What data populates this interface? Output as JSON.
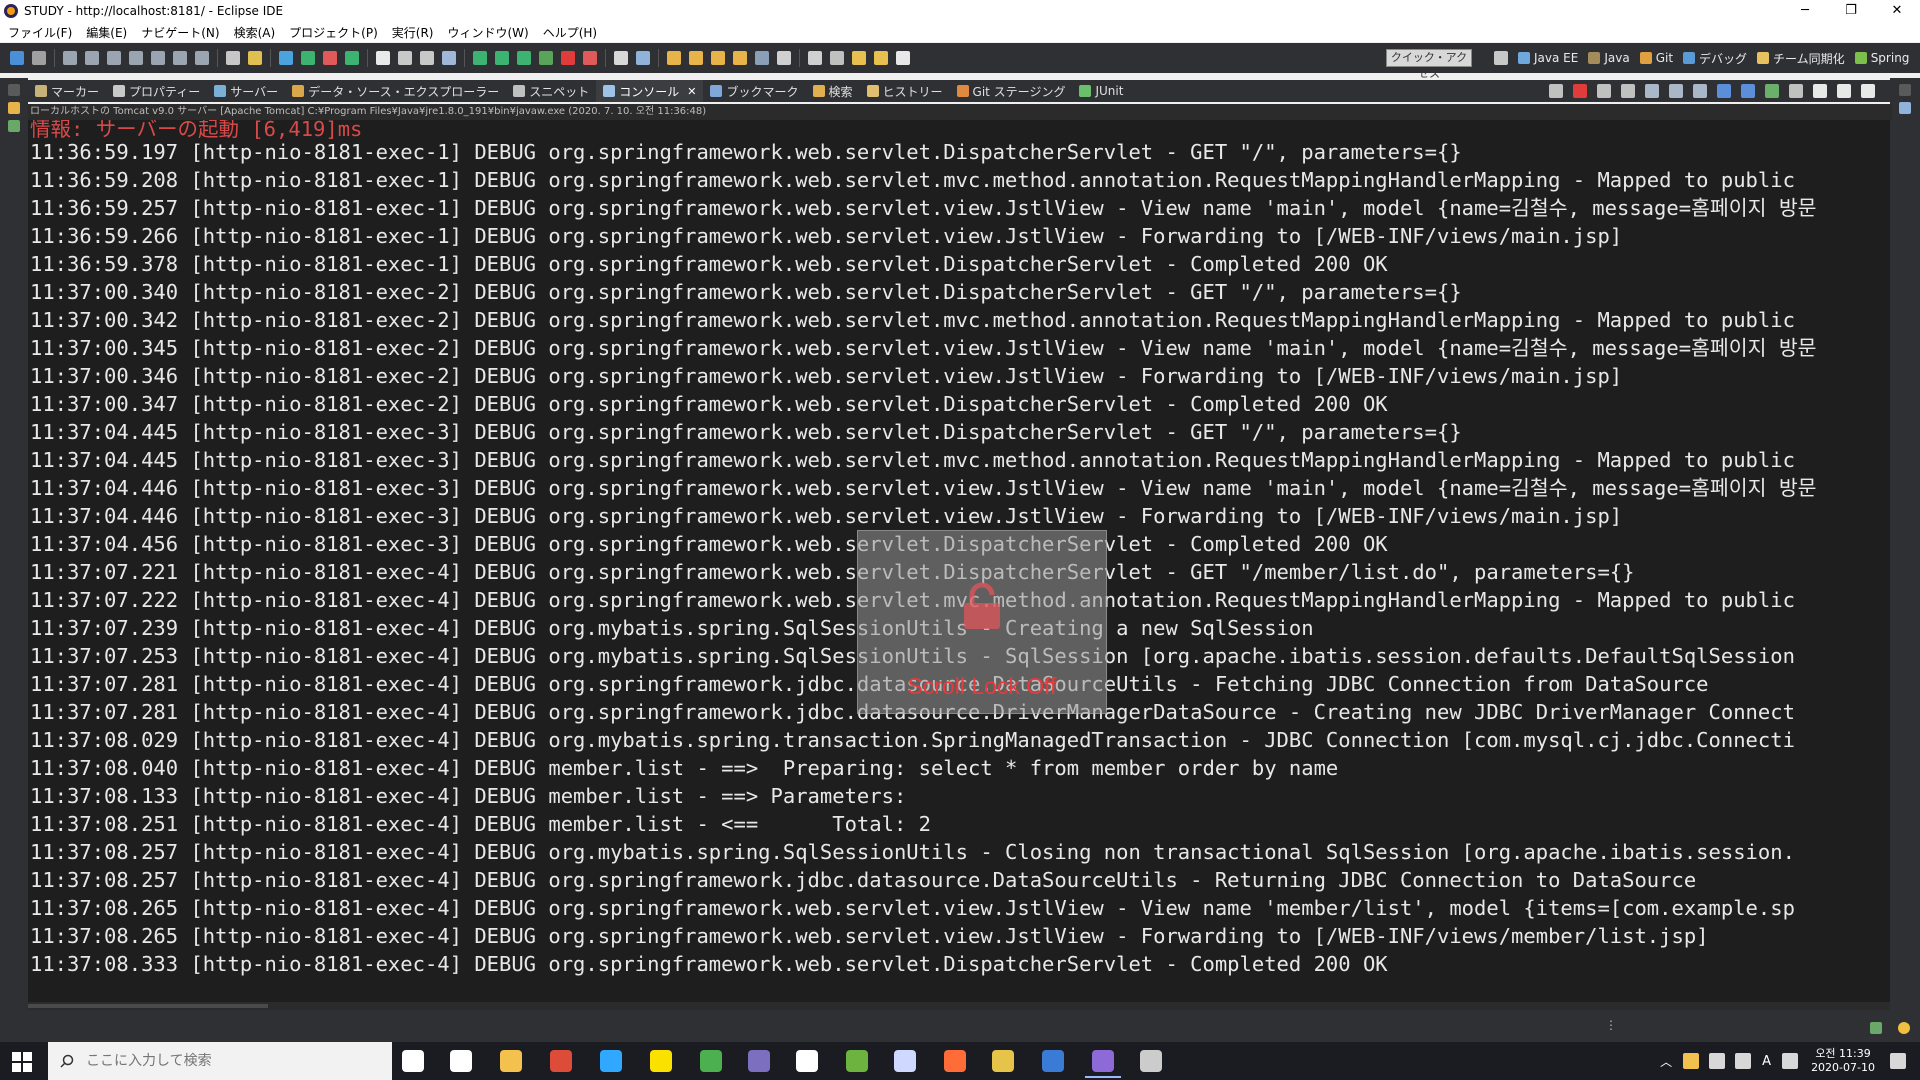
{
  "window": {
    "title": "STUDY - http://localhost:8181/ - Eclipse IDE",
    "controls": {
      "minimize": "─",
      "maximize": "❐",
      "close": "✕"
    }
  },
  "menu": {
    "items": [
      "ファイル(F)",
      "編集(E)",
      "ナビゲート(N)",
      "検索(A)",
      "プロジェクト(P)",
      "実行(R)",
      "ウィンドウ(W)",
      "ヘルプ(H)"
    ]
  },
  "toolbar": {
    "quick_access": "クイック・アクセス",
    "perspectives": [
      {
        "label": "Java EE",
        "color": "#6fa8dc",
        "icon": "javaee-perspective-icon"
      },
      {
        "label": "Java",
        "color": "#a48b5a",
        "icon": "java-perspective-icon"
      },
      {
        "label": "Git",
        "color": "#e0a040",
        "icon": "git-perspective-icon"
      },
      {
        "label": "デバッグ",
        "color": "#5b9bd5",
        "icon": "debug-perspective-icon"
      },
      {
        "label": "チーム同期化",
        "color": "#e8c060",
        "icon": "team-sync-icon"
      },
      {
        "label": "Spring",
        "color": "#7cbf4a",
        "icon": "spring-perspective-icon"
      }
    ]
  },
  "view_tabs": [
    {
      "label": "マーカー",
      "icon": "markers-icon",
      "color": "#c9b27a"
    },
    {
      "label": "プロパティー",
      "icon": "properties-icon",
      "color": "#c8c8c8"
    },
    {
      "label": "サーバー",
      "icon": "servers-icon",
      "color": "#7ab0d8"
    },
    {
      "label": "データ・ソース・エクスプローラー",
      "icon": "data-source-icon",
      "color": "#d8a84a"
    },
    {
      "label": "スニペット",
      "icon": "snippets-icon",
      "color": "#bfbfbf"
    },
    {
      "label": "コンソール",
      "icon": "console-icon",
      "color": "#9fc3e8",
      "active": true
    },
    {
      "label": "ブックマーク",
      "icon": "bookmarks-icon",
      "color": "#7fa7d9"
    },
    {
      "label": "検索",
      "icon": "search-view-icon",
      "color": "#e0b050"
    },
    {
      "label": "ヒストリー",
      "icon": "history-icon",
      "color": "#e0c070"
    },
    {
      "label": "Git ステージング",
      "icon": "git-staging-icon",
      "color": "#e08a40"
    },
    {
      "label": "JUnit",
      "icon": "junit-icon",
      "color": "#6abf6a"
    }
  ],
  "console": {
    "description": "ローカルホストの Tomcat v9.0 サーバー [Apache Tomcat] C:¥Program Files¥Java¥jre1.8.0_191¥bin¥javaw.exe (2020. 7. 10. 오전 11:36:48)",
    "partial_line": "情報: サーバーの起動 [6,419]ms",
    "lines": [
      "11:36:59.197 [http-nio-8181-exec-1] DEBUG org.springframework.web.servlet.DispatcherServlet - GET \"/\", parameters={}",
      "11:36:59.208 [http-nio-8181-exec-1] DEBUG org.springframework.web.servlet.mvc.method.annotation.RequestMappingHandlerMapping - Mapped to public",
      "11:36:59.257 [http-nio-8181-exec-1] DEBUG org.springframework.web.servlet.view.JstlView - View name 'main', model {name=김철수, message=홈페이지 방문",
      "11:36:59.266 [http-nio-8181-exec-1] DEBUG org.springframework.web.servlet.view.JstlView - Forwarding to [/WEB-INF/views/main.jsp]",
      "11:36:59.378 [http-nio-8181-exec-1] DEBUG org.springframework.web.servlet.DispatcherServlet - Completed 200 OK",
      "11:37:00.340 [http-nio-8181-exec-2] DEBUG org.springframework.web.servlet.DispatcherServlet - GET \"/\", parameters={}",
      "11:37:00.342 [http-nio-8181-exec-2] DEBUG org.springframework.web.servlet.mvc.method.annotation.RequestMappingHandlerMapping - Mapped to public",
      "11:37:00.345 [http-nio-8181-exec-2] DEBUG org.springframework.web.servlet.view.JstlView - View name 'main', model {name=김철수, message=홈페이지 방문",
      "11:37:00.346 [http-nio-8181-exec-2] DEBUG org.springframework.web.servlet.view.JstlView - Forwarding to [/WEB-INF/views/main.jsp]",
      "11:37:00.347 [http-nio-8181-exec-2] DEBUG org.springframework.web.servlet.DispatcherServlet - Completed 200 OK",
      "11:37:04.445 [http-nio-8181-exec-3] DEBUG org.springframework.web.servlet.DispatcherServlet - GET \"/\", parameters={}",
      "11:37:04.445 [http-nio-8181-exec-3] DEBUG org.springframework.web.servlet.mvc.method.annotation.RequestMappingHandlerMapping - Mapped to public",
      "11:37:04.446 [http-nio-8181-exec-3] DEBUG org.springframework.web.servlet.view.JstlView - View name 'main', model {name=김철수, message=홈페이지 방문",
      "11:37:04.446 [http-nio-8181-exec-3] DEBUG org.springframework.web.servlet.view.JstlView - Forwarding to [/WEB-INF/views/main.jsp]",
      "11:37:04.456 [http-nio-8181-exec-3] DEBUG org.springframework.web.servlet.DispatcherServlet - Completed 200 OK",
      "11:37:07.221 [http-nio-8181-exec-4] DEBUG org.springframework.web.servlet.DispatcherServlet - GET \"/member/list.do\", parameters={}",
      "11:37:07.222 [http-nio-8181-exec-4] DEBUG org.springframework.web.servlet.mvc.method.annotation.RequestMappingHandlerMapping - Mapped to public",
      "11:37:07.239 [http-nio-8181-exec-4] DEBUG org.mybatis.spring.SqlSessionUtils - Creating a new SqlSession",
      "11:37:07.253 [http-nio-8181-exec-4] DEBUG org.mybatis.spring.SqlSessionUtils - SqlSession [org.apache.ibatis.session.defaults.DefaultSqlSession",
      "11:37:07.281 [http-nio-8181-exec-4] DEBUG org.springframework.jdbc.datasource.DataSourceUtils - Fetching JDBC Connection from DataSource",
      "11:37:07.281 [http-nio-8181-exec-4] DEBUG org.springframework.jdbc.datasource.DriverManagerDataSource - Creating new JDBC DriverManager Connect",
      "11:37:08.029 [http-nio-8181-exec-4] DEBUG org.mybatis.spring.transaction.SpringManagedTransaction - JDBC Connection [com.mysql.cj.jdbc.Connecti",
      "11:37:08.040 [http-nio-8181-exec-4] DEBUG member.list - ==>  Preparing: select * from member order by name",
      "11:37:08.133 [http-nio-8181-exec-4] DEBUG member.list - ==> Parameters: ",
      "11:37:08.251 [http-nio-8181-exec-4] DEBUG member.list - <==      Total: 2",
      "11:37:08.257 [http-nio-8181-exec-4] DEBUG org.mybatis.spring.SqlSessionUtils - Closing non transactional SqlSession [org.apache.ibatis.session.",
      "11:37:08.257 [http-nio-8181-exec-4] DEBUG org.springframework.jdbc.datasource.DataSourceUtils - Returning JDBC Connection to DataSource",
      "11:37:08.265 [http-nio-8181-exec-4] DEBUG org.springframework.web.servlet.view.JstlView - View name 'member/list', model {items=[com.example.sp",
      "11:37:08.265 [http-nio-8181-exec-4] DEBUG org.springframework.web.servlet.view.JstlView - Forwarding to [/WEB-INF/views/member/list.jsp]",
      "11:37:08.333 [http-nio-8181-exec-4] DEBUG org.springframework.web.servlet.DispatcherServlet - Completed 200 OK"
    ],
    "overlay": "Scroll Lock Off"
  },
  "taskbar": {
    "search_placeholder": "ここに入力して検索",
    "apps": [
      {
        "name": "cortana-icon",
        "color": "#ffffff"
      },
      {
        "name": "task-view-icon",
        "color": "#ffffff"
      },
      {
        "name": "file-explorer-icon",
        "color": "#f2c14e"
      },
      {
        "name": "chrome-icon",
        "color": "#dd4b39"
      },
      {
        "name": "photoshop-icon",
        "color": "#31a8ff"
      },
      {
        "name": "kakaotalk-icon",
        "color": "#fae100"
      },
      {
        "name": "media-icon",
        "color": "#4caf50"
      },
      {
        "name": "eclipse-icon",
        "color": "#7c6fbf"
      },
      {
        "name": "notes-icon",
        "color": "#ffffff"
      },
      {
        "name": "spring-tool-icon",
        "color": "#6db33f"
      },
      {
        "name": "app-icon",
        "color": "#cfd8ff"
      },
      {
        "name": "postman-icon",
        "color": "#ff6c37"
      },
      {
        "name": "typora-icon",
        "color": "#e6c44a"
      },
      {
        "name": "network-app-icon",
        "color": "#3a7bd5"
      },
      {
        "name": "eclipse-study-icon",
        "color": "#8e6ad8",
        "active": true
      },
      {
        "name": "terminal-icon",
        "color": "#cccccc"
      }
    ],
    "tray": {
      "ime": "A",
      "clock_time": "오전 11:39",
      "clock_date": "2020-07-10"
    }
  }
}
